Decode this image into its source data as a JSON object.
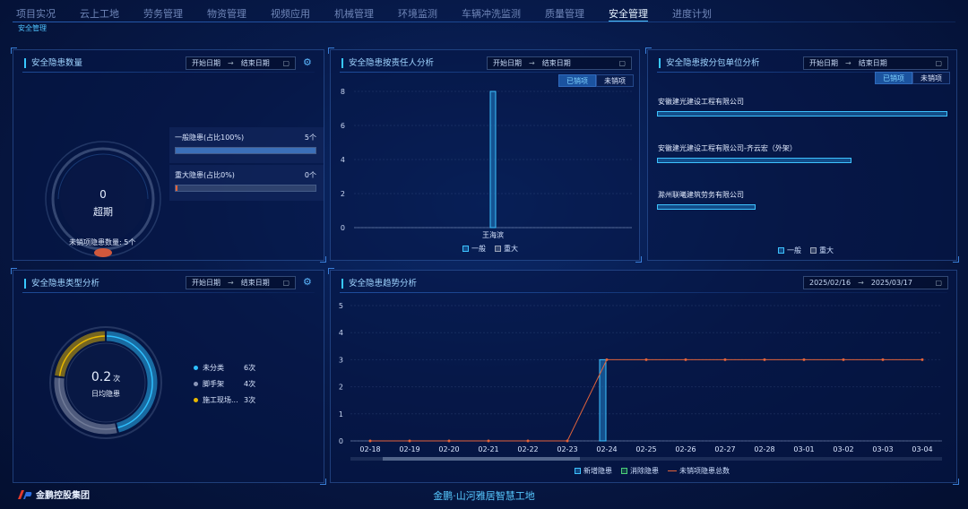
{
  "nav": {
    "items": [
      "项目实况",
      "云上工地",
      "劳务管理",
      "物资管理",
      "视频应用",
      "机械管理",
      "环境监测",
      "车辆冲洗监测",
      "质量管理",
      "安全管理",
      "进度计划"
    ],
    "active_index": 9
  },
  "breadcrumb": "安全管理",
  "date_range": {
    "start_placeholder": "开始日期",
    "end_placeholder": "结束日期"
  },
  "hazard_count": {
    "title": "安全隐患数量",
    "ring_value": "0",
    "ring_label": "超期",
    "general_label": "一般隐患(占比100%)",
    "general_count": "5个",
    "general_fraction": 1.0,
    "major_label": "重大隐患(占比0%)",
    "major_count": "0个",
    "major_fraction": 0.0,
    "unclosed_text": "未销项隐患数量: 5个"
  },
  "by_person": {
    "title": "安全隐患按责任人分析",
    "toggle": [
      "已销项",
      "未销项"
    ],
    "legend": [
      "一般",
      "重大"
    ]
  },
  "by_subcontractor": {
    "title": "安全隐患按分包单位分析",
    "toggle": [
      "已销项",
      "未销项"
    ],
    "companies": [
      {
        "name": "安徽建光建设工程有限公司",
        "fraction": 1.0
      },
      {
        "name": "安徽建光建设工程有限公司-齐云宏（外架）",
        "fraction": 0.67
      },
      {
        "name": "滁州联曦建筑劳务有限公司",
        "fraction": 0.34
      }
    ],
    "legend": [
      "一般",
      "重大"
    ]
  },
  "by_type": {
    "title": "安全隐患类型分析",
    "center_value": "0.2",
    "center_unit": "次",
    "center_label": "日均隐患",
    "items": [
      {
        "name": "未分类",
        "count": "6次",
        "color": "#2ec0ff"
      },
      {
        "name": "脚手架",
        "count": "4次",
        "color": "#8a96b8"
      },
      {
        "name": "施工现场...",
        "count": "3次",
        "color": "#e8b800"
      }
    ]
  },
  "trend": {
    "title": "安全隐患趋势分析",
    "start_date": "2025/02/16",
    "end_date": "2025/03/17",
    "legend": [
      "新增隐患",
      "消除隐患",
      "未销项隐患总数"
    ]
  },
  "colors": {
    "accent": "#38c7ff",
    "general": "#1f86c9",
    "major": "#9aa3b8",
    "line": "#e2633b"
  },
  "chart_data": [
    {
      "type": "bar",
      "categories": [
        "王海滨"
      ],
      "series": [
        {
          "name": "一般",
          "values": [
            8
          ]
        },
        {
          "name": "重大",
          "values": [
            0
          ]
        }
      ],
      "yticks": [
        0,
        2,
        4,
        6,
        8
      ],
      "ylim": [
        0,
        8
      ]
    },
    {
      "type": "bar",
      "categories": [
        "02-18",
        "02-19",
        "02-20",
        "02-21",
        "02-22",
        "02-23",
        "02-24",
        "02-25",
        "02-26",
        "02-27",
        "02-28",
        "03-01",
        "03-02",
        "03-03",
        "03-04"
      ],
      "series": [
        {
          "name": "新增隐患",
          "values": [
            0,
            0,
            0,
            0,
            0,
            0,
            3,
            0,
            0,
            0,
            0,
            0,
            0,
            0,
            0
          ]
        },
        {
          "name": "消除隐患",
          "values": [
            0,
            0,
            0,
            0,
            0,
            0,
            0,
            0,
            0,
            0,
            0,
            0,
            0,
            0,
            0
          ]
        },
        {
          "name": "未销项隐患总数",
          "type": "line",
          "values": [
            0,
            0,
            0,
            0,
            0,
            0,
            3,
            3,
            3,
            3,
            3,
            3,
            3,
            3,
            3
          ]
        }
      ],
      "yticks": [
        0,
        1,
        2,
        3,
        4,
        5
      ],
      "ylim": [
        0,
        5
      ]
    }
  ],
  "footer": {
    "site_title": "金鹏·山河雅居智慧工地",
    "logo_text": "金鹏控股集团"
  }
}
